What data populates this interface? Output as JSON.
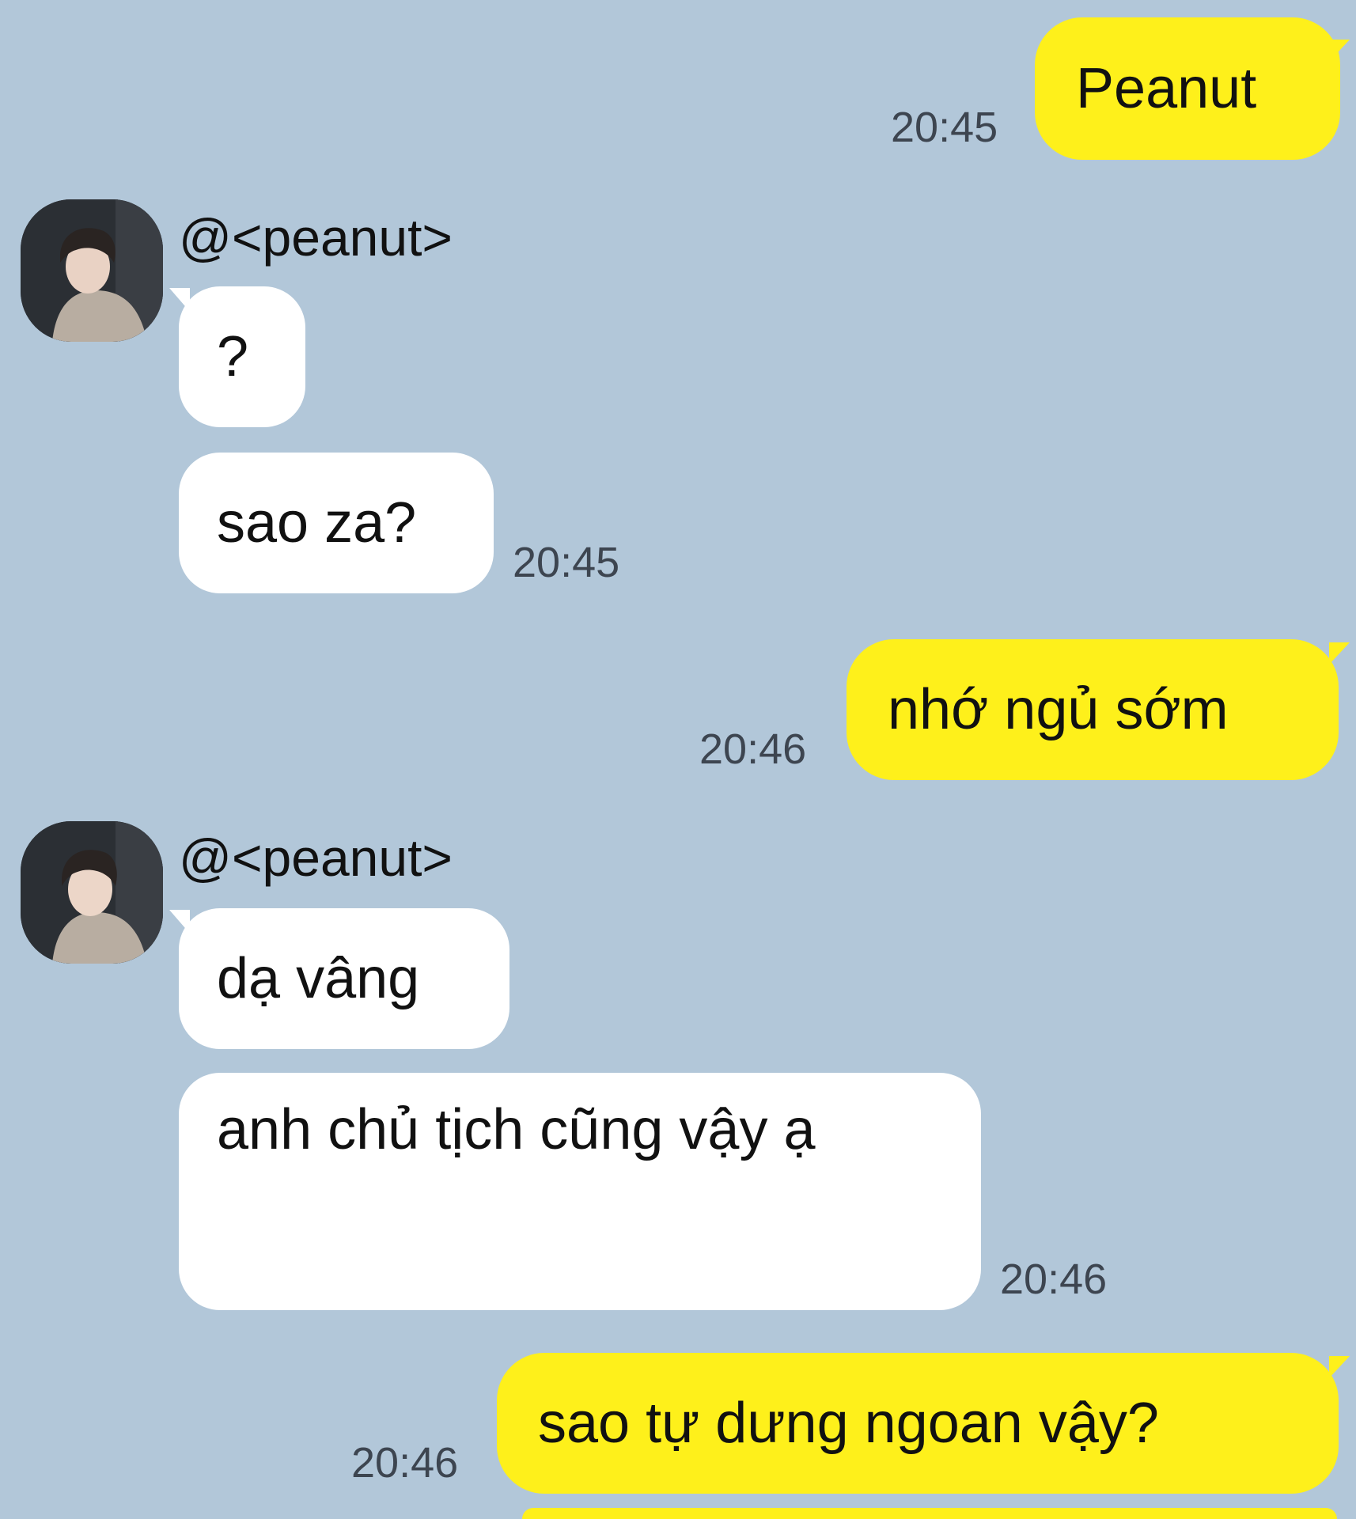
{
  "conversation": {
    "messages": [
      {
        "id": "m1",
        "side": "out",
        "text": "Peanut",
        "time": "20:45"
      },
      {
        "id": "m2",
        "side": "in",
        "sender": "@<peanut>",
        "text": "?",
        "time": ""
      },
      {
        "id": "m3",
        "side": "in",
        "text": "sao za?",
        "time": "20:45"
      },
      {
        "id": "m4",
        "side": "out",
        "text": "nhớ ngủ sớm",
        "time": "20:46"
      },
      {
        "id": "m5",
        "side": "in",
        "sender": "@<peanut>",
        "text": "dạ vâng",
        "time": ""
      },
      {
        "id": "m6",
        "side": "in",
        "text": "anh chủ tịch cũng vậy ạ",
        "time": "20:46"
      },
      {
        "id": "m7",
        "side": "out",
        "text": "sao tự dưng ngoan vậy?",
        "time": "20:46"
      }
    ]
  },
  "colors": {
    "background": "#b2c7d9",
    "outgoing_bubble": "#fef01b",
    "incoming_bubble": "#ffffff",
    "timestamp": "#3d4550"
  },
  "icons": {
    "avatar": "profile-photo-avatar"
  }
}
